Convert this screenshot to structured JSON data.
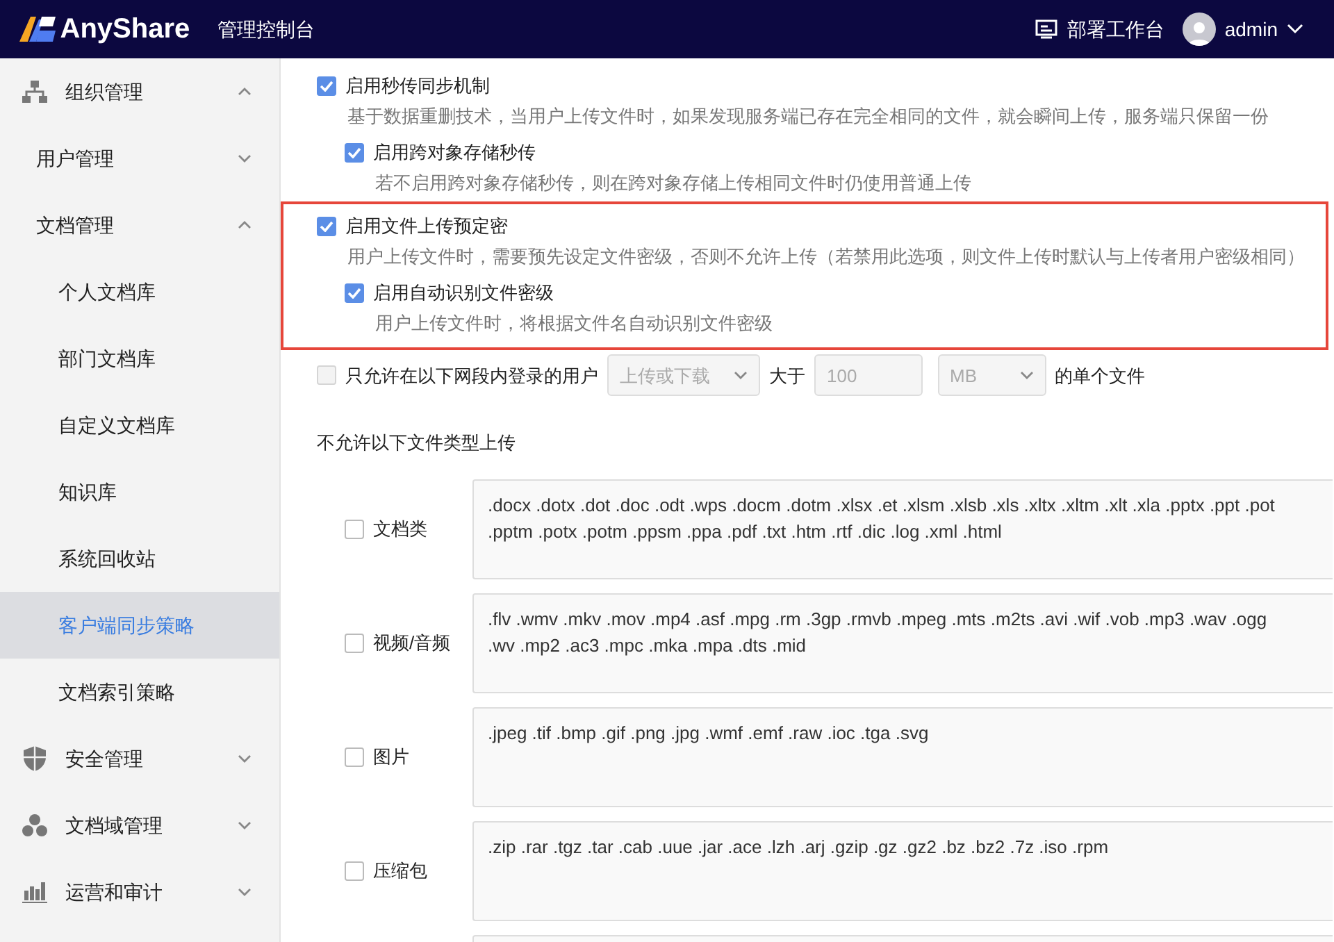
{
  "header": {
    "logo_text": "AnyShare",
    "title": "管理控制台",
    "workbench": "部署工作台",
    "user": "admin"
  },
  "sidebar": {
    "items": [
      {
        "label": "组织管理",
        "kind": "org",
        "expanded": true,
        "selected": false,
        "children": [
          {
            "label": "用户管理",
            "expanded": false,
            "selected": false
          },
          {
            "label": "文档管理",
            "expanded": true,
            "selected": false,
            "children": [
              {
                "label": "个人文档库",
                "selected": false
              },
              {
                "label": "部门文档库",
                "selected": false
              },
              {
                "label": "自定义文档库",
                "selected": false
              },
              {
                "label": "知识库",
                "selected": false
              },
              {
                "label": "系统回收站",
                "selected": false
              },
              {
                "label": "客户端同步策略",
                "selected": true
              },
              {
                "label": "文档索引策略",
                "selected": false
              }
            ]
          }
        ]
      },
      {
        "label": "安全管理",
        "kind": "shield",
        "expanded": false,
        "selected": false
      },
      {
        "label": "文档域管理",
        "kind": "cluster",
        "expanded": false,
        "selected": false
      },
      {
        "label": "运营和审计",
        "kind": "chart",
        "expanded": false,
        "selected": false
      }
    ]
  },
  "options": [
    {
      "label": "启用秒传同步机制",
      "checked": true,
      "highlighted": false,
      "description": "基于数据重删技术，当用户上传文件时，如果发现服务端已存在完全相同的文件，就会瞬间上传，服务端只保留一份",
      "children": [
        {
          "label": "启用跨对象存储秒传",
          "checked": true,
          "description": "若不启用跨对象存储秒传，则在跨对象存储上传相同文件时仍使用普通上传"
        }
      ]
    },
    {
      "label": "启用文件上传预定密",
      "checked": true,
      "highlighted": true,
      "description": "用户上传文件时，需要预先设定文件密级，否则不允许上传（若禁用此选项，则文件上传时默认与上传者用户密级相同）",
      "children": [
        {
          "label": "启用自动识别文件密级",
          "checked": true,
          "description": "用户上传文件时，将根据文件名自动识别文件密级"
        }
      ]
    }
  ],
  "network_restriction": {
    "checked": false,
    "label": "只允许在以下网段内登录的用户",
    "direction": "上传或下载",
    "greater_than": "大于",
    "size": "100",
    "unit": "MB",
    "suffix": "的单个文件",
    "disabled": true
  },
  "blocked_types": {
    "title": "不允许以下文件类型上传",
    "categories": [
      {
        "label": "文档类",
        "checked": false,
        "extensions": [
          ".docx .dotx .dot .doc .odt .wps .docm .dotm .xlsx .et .xlsm .xlsb .xls .xltx .xltm .xlt .xla .pptx .ppt .pot",
          ".pptm .potx .potm .ppsm .ppa .pdf .txt .htm .rtf .dic .log .xml .html"
        ]
      },
      {
        "label": "视频/音频",
        "checked": false,
        "extensions": [
          ".flv .wmv .mkv .mov .mp4 .asf .mpg .rm .3gp .rmvb .mpeg .mts .m2ts .avi .wif .vob .mp3 .wav .ogg",
          ".wv .mp2 .ac3 .mpc .mka .mpa .dts .mid"
        ]
      },
      {
        "label": "图片",
        "checked": false,
        "extensions": [
          ".jpeg .tif .bmp .gif .png .jpg .wmf .emf .raw .ioc .tga .svg"
        ]
      },
      {
        "label": "压缩包",
        "checked": false,
        "extensions": [
          ".zip .rar .tgz .tar .cab .uue .jar .ace .lzh .arj .gzip .gz .gz2 .bz .bz2 .7z .iso .rpm"
        ]
      }
    ]
  }
}
